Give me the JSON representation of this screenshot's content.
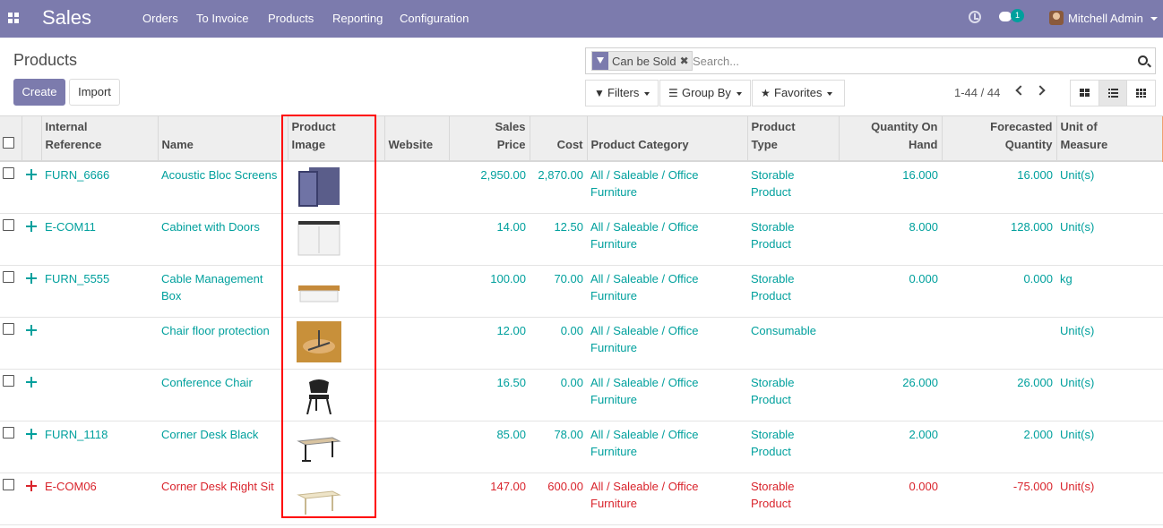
{
  "nav": {
    "app_name": "Sales",
    "menu": [
      "Orders",
      "To Invoice",
      "Products",
      "Reporting",
      "Configuration"
    ],
    "chat_badge": "1",
    "user_name": "Mitchell Admin"
  },
  "control_panel": {
    "title": "Products",
    "create_label": "Create",
    "import_label": "Import",
    "search": {
      "facet_value": "Can be Sold",
      "placeholder": "Search..."
    },
    "filters_label": "Filters",
    "group_by_label": "Group By",
    "favorites_label": "Favorites",
    "pager": "1-44 / 44"
  },
  "table": {
    "headers": {
      "internal_reference": [
        "Internal",
        "Reference"
      ],
      "name": "Name",
      "product_image": [
        "Product",
        "Image"
      ],
      "website": "Website",
      "sales_price": [
        "Sales",
        "Price"
      ],
      "cost": "Cost",
      "product_category": "Product Category",
      "product_type": [
        "Product",
        "Type"
      ],
      "qty_on_hand": [
        "Quantity On",
        "Hand"
      ],
      "forecasted": [
        "Forecasted",
        "Quantity"
      ],
      "uom": [
        "Unit of",
        "Measure"
      ]
    },
    "rows": [
      {
        "ref": "FURN_6666",
        "name": "Acoustic Bloc Screens",
        "image": "acoustic-screens",
        "price": "2,950.00",
        "cost": "2,870.00",
        "category": "All / Saleable / Office Furniture",
        "type": "Storable Product",
        "on_hand": "16.000",
        "forecast": "16.000",
        "uom": "Unit(s)"
      },
      {
        "ref": "E-COM11",
        "name": "Cabinet with Doors",
        "image": "cabinet",
        "price": "14.00",
        "cost": "12.50",
        "category": "All / Saleable / Office Furniture",
        "type": "Storable Product",
        "on_hand": "8.000",
        "forecast": "128.000",
        "uom": "Unit(s)"
      },
      {
        "ref": "FURN_5555",
        "name": "Cable Management Box",
        "image": "cable-box",
        "price": "100.00",
        "cost": "70.00",
        "category": "All / Saleable / Office Furniture",
        "type": "Storable Product",
        "on_hand": "0.000",
        "forecast": "0.000",
        "uom": "kg"
      },
      {
        "ref": "",
        "name": "Chair floor protection",
        "image": "floor-protection",
        "price": "12.00",
        "cost": "0.00",
        "category": "All / Saleable / Office Furniture",
        "type": "Consumable",
        "on_hand": "",
        "forecast": "",
        "uom": "Unit(s)"
      },
      {
        "ref": "",
        "name": "Conference Chair",
        "image": "conference-chair",
        "price": "16.50",
        "cost": "0.00",
        "category": "All / Saleable / Office Furniture",
        "type": "Storable Product",
        "on_hand": "26.000",
        "forecast": "26.000",
        "uom": "Unit(s)"
      },
      {
        "ref": "FURN_1118",
        "name": "Corner Desk Black",
        "image": "corner-desk-black",
        "price": "85.00",
        "cost": "78.00",
        "category": "All / Saleable / Office Furniture",
        "type": "Storable Product",
        "on_hand": "2.000",
        "forecast": "2.000",
        "uom": "Unit(s)"
      },
      {
        "ref": "E-COM06",
        "name": "Corner Desk Right Sit",
        "image": "corner-desk-right",
        "price": "147.00",
        "cost": "600.00",
        "category": "All / Saleable / Office Furniture",
        "type": "Storable Product",
        "on_hand": "0.000",
        "forecast": "-75.000",
        "uom": "Unit(s)"
      }
    ]
  },
  "colors": {
    "brand": "#7c7bad",
    "link": "#00a09d",
    "negative": "#d9242c",
    "highlight": "#ff0000"
  }
}
